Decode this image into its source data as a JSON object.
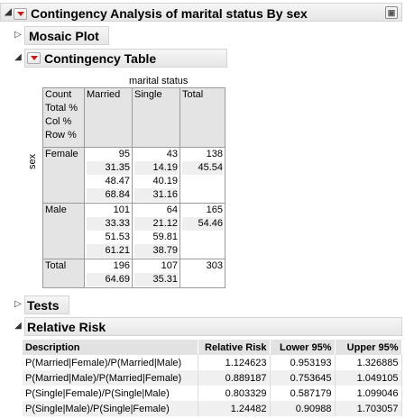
{
  "report": {
    "title": "Contingency Analysis of marital status By sex",
    "corner_icon": "report-options-icon"
  },
  "sections": {
    "mosaic": "Mosaic Plot",
    "contingency": "Contingency Table",
    "tests": "Tests",
    "relative_risk": "Relative Risk"
  },
  "contingency_table": {
    "column_variable": "marital status",
    "row_variable": "sex",
    "legend": [
      "Count",
      "Total %",
      "Col %",
      "Row %"
    ],
    "columns": [
      "Married",
      "Single",
      "Total"
    ],
    "rows": [
      {
        "label": "Female",
        "married": [
          "95",
          "31.35",
          "48.47",
          "68.84"
        ],
        "single": [
          "43",
          "14.19",
          "40.19",
          "31.16"
        ],
        "total": [
          "138",
          "45.54"
        ]
      },
      {
        "label": "Male",
        "married": [
          "101",
          "33.33",
          "51.53",
          "61.21"
        ],
        "single": [
          "64",
          "21.12",
          "59.81",
          "38.79"
        ],
        "total": [
          "165",
          "54.46"
        ]
      },
      {
        "label": "Total",
        "married": [
          "196",
          "64.69"
        ],
        "single": [
          "107",
          "35.31"
        ],
        "total": [
          "303"
        ]
      }
    ]
  },
  "relative_risk": {
    "headers": [
      "Description",
      "Relative Risk",
      "Lower 95%",
      "Upper 95%"
    ],
    "rows": [
      [
        "P(Married|Female)/P(Married|Male)",
        "1.124623",
        "0.953193",
        "1.326885"
      ],
      [
        "P(Married|Male)/P(Married|Female)",
        "0.889187",
        "0.753645",
        "1.049105"
      ],
      [
        "P(Single|Female)/P(Single|Male)",
        "0.803329",
        "0.587179",
        "1.099046"
      ],
      [
        "P(Single|Male)/P(Single|Female)",
        "1.24482",
        "0.90988",
        "1.703057"
      ]
    ]
  },
  "colors": {
    "red_triangle": "#d01818",
    "header_bg": "#e6e6e6",
    "shade": "#e4e4e4"
  }
}
